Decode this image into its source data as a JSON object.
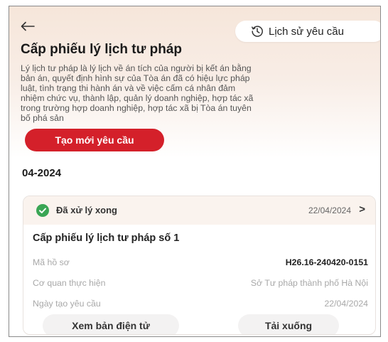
{
  "header": {
    "back_icon": "arrow-left-icon",
    "history_icon": "clock-history-icon",
    "history_label": "Lịch sử yêu cầu"
  },
  "page": {
    "title": "Cấp phiếu lý lịch tư pháp",
    "description_lines": [
      "Lý lịch tư pháp là lý lịch về án tích của người bị kết án bằng",
      "bản án, quyết định hình sự của Tòa án đã có hiệu lực pháp",
      "luật, tình trạng thi hành án và về việc cấm cá nhân đảm",
      "nhiệm chức vụ, thành lập, quản lý doanh nghiệp, hợp tác xã",
      "trong trường hợp doanh nghiệp, hợp tác xã bị Tòa án tuyên",
      "bố phá sản"
    ],
    "create_button": "Tạo mới yêu cầu"
  },
  "records_section": {
    "month": "04-2024",
    "card": {
      "status_icon": "check-circle-icon",
      "status": "Đã xử lý xong",
      "status_color": "#3aa655",
      "date": "22/04/2024",
      "chevron": ">",
      "title": "Cấp phiếu lý lịch tư pháp số 1",
      "fields": [
        {
          "label": "Mã hồ sơ",
          "value": "H26.16-240420-0151"
        },
        {
          "label": "Cơ quan thực hiện",
          "value": "Sở Tư pháp thành phố Hà Nội"
        },
        {
          "label": "Ngày tạo yêu cầu",
          "value": "22/04/2024"
        }
      ],
      "view_button": "Xem bản điện tử",
      "download_button": "Tải xuống"
    }
  },
  "colors": {
    "accent": "#d4202a",
    "success": "#3aa655"
  }
}
